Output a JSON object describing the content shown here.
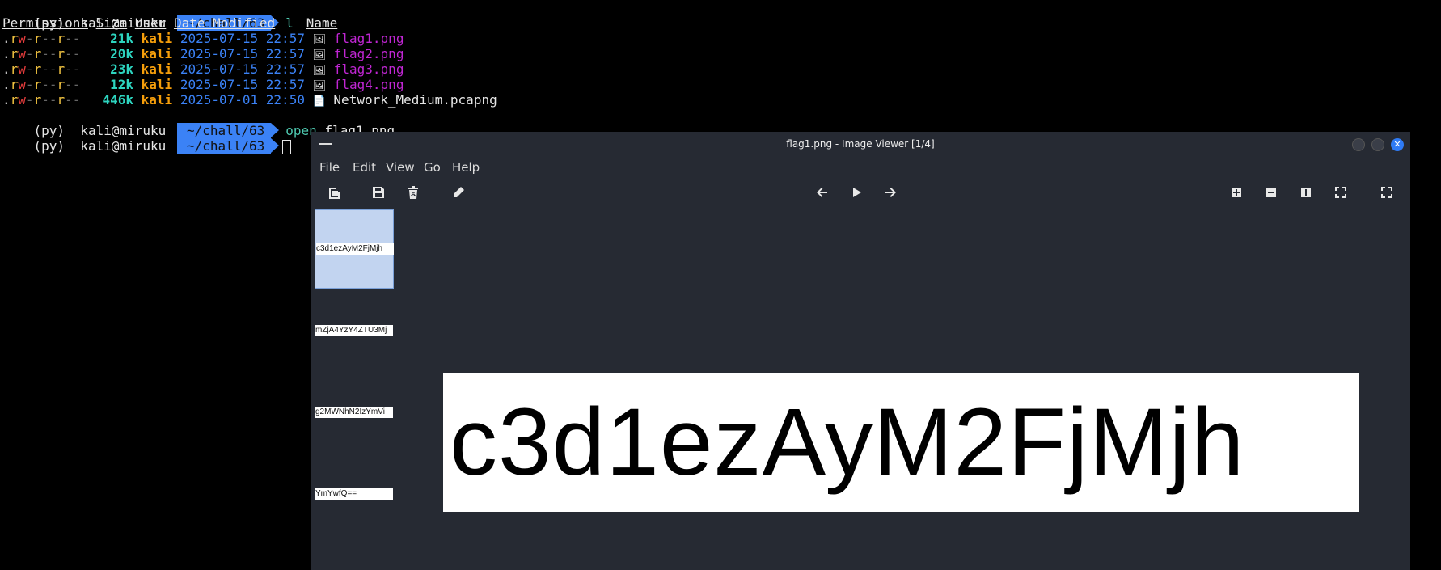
{
  "terminal": {
    "prompt": {
      "env": "(py)",
      "user_host": "kali@miruku",
      "path": "~/chall/63"
    },
    "cmd1": "l",
    "headers": {
      "permissions": "Permissions",
      "size": "Size",
      "user": "User",
      "date": "Date Modified",
      "name": "Name"
    },
    "files": [
      {
        "size": "21k",
        "user": "kali",
        "date": "2025-07-15 22:57",
        "name": "flag1.png",
        "type": "image"
      },
      {
        "size": "20k",
        "user": "kali",
        "date": "2025-07-15 22:57",
        "name": "flag2.png",
        "type": "image"
      },
      {
        "size": "23k",
        "user": "kali",
        "date": "2025-07-15 22:57",
        "name": "flag3.png",
        "type": "image"
      },
      {
        "size": "12k",
        "user": "kali",
        "date": "2025-07-15 22:57",
        "name": "flag4.png",
        "type": "image"
      },
      {
        "size": "446k",
        "user": "kali",
        "date": "2025-07-01 22:50",
        "name": "Network_Medium.pcapng",
        "type": "file"
      }
    ],
    "cmd2_verb": "open",
    "cmd2_arg": "flag1.png"
  },
  "viewer": {
    "title": "flag1.png - Image Viewer [1/4]",
    "menu": [
      "File",
      "Edit",
      "View",
      "Go",
      "Help"
    ],
    "thumbnails": [
      "c3d1ezAyM2FjMjh",
      "mZjA4YzY4ZTU3Mj",
      "g2MWNhN2IzYmVi",
      "YmYwfQ=="
    ],
    "selected_index": 0,
    "image_text": "c3d1ezAyM2FjMjh",
    "accent": "#2f7bf5",
    "close_glyph": "✕"
  }
}
